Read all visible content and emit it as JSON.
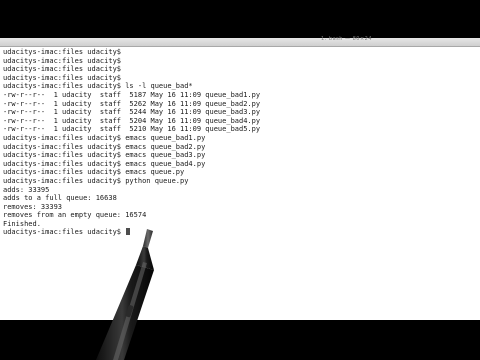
{
  "window": {
    "title": "1. bash — 80×24"
  },
  "terminal": {
    "lines": [
      "udacitys-imac:files udacity$",
      "udacitys-imac:files udacity$",
      "udacitys-imac:files udacity$",
      "udacitys-imac:files udacity$",
      "udacitys-imac:files udacity$ ls -l queue_bad*",
      "-rw-r--r--  1 udacity  staff  5187 May 16 11:09 queue_bad1.py",
      "-rw-r--r--  1 udacity  staff  5262 May 16 11:09 queue_bad2.py",
      "-rw-r--r--  1 udacity  staff  5244 May 16 11:09 queue_bad3.py",
      "-rw-r--r--  1 udacity  staff  5204 May 16 11:09 queue_bad4.py",
      "-rw-r--r--  1 udacity  staff  5210 May 16 11:09 queue_bad5.py",
      "udacitys-imac:files udacity$ emacs queue_bad1.py",
      "udacitys-imac:files udacity$ emacs queue_bad2.py",
      "udacitys-imac:files udacity$ emacs queue_bad3.py",
      "udacitys-imac:files udacity$ emacs queue_bad4.py",
      "udacitys-imac:files udacity$ emacs queue.py",
      "udacitys-imac:files udacity$ python queue.py",
      "adds: 33395",
      "adds to a full queue: 16638",
      "removes: 33393",
      "removes from an empty queue: 16574",
      "Finished.",
      "udacitys-imac:files udacity$"
    ]
  },
  "colors": {
    "background": "#000000",
    "terminal_bg": "#ffffff",
    "terminal_text": "#1a1a1a"
  }
}
